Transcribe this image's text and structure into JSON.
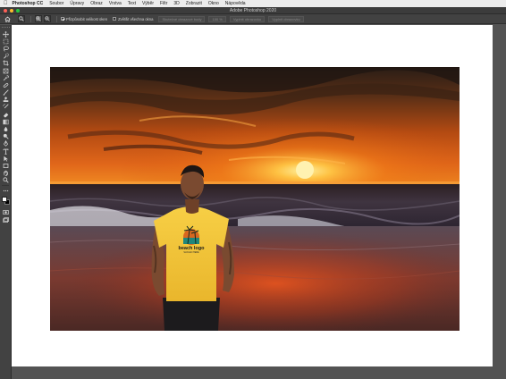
{
  "menubar": {
    "app_name": "Photoshop CC",
    "items": [
      "Soubor",
      "Úpravy",
      "Obraz",
      "Vrstva",
      "Text",
      "Výběr",
      "Filtr",
      "3D",
      "Zobrazit",
      "Okno",
      "Nápověda"
    ]
  },
  "window": {
    "title": "Adobe Photoshop 2020"
  },
  "options": {
    "checkbox1_label": "Přizpůsobit velikost oken",
    "checkbox1_checked": true,
    "checkbox2_label": "Zvětšit všechna okna",
    "checkbox2_checked": false,
    "buttons": [
      "Skutečné obrazové body",
      "100 %",
      "Vyplnit obrazovku",
      "Vyplnit obrazovku"
    ]
  },
  "tools": [
    "move-tool",
    "marquee-tool",
    "lasso-tool",
    "quick-select-tool",
    "crop-tool",
    "frame-tool",
    "eyedropper-tool",
    "healing-brush-tool",
    "brush-tool",
    "clone-stamp-tool",
    "history-brush-tool",
    "eraser-tool",
    "gradient-tool",
    "blur-tool",
    "dodge-tool",
    "pen-tool",
    "type-tool",
    "path-select-tool",
    "rectangle-tool",
    "hand-tool",
    "zoom-tool",
    "more-tools"
  ],
  "colors": {
    "foreground": "#ffffff",
    "background": "#000000",
    "ui_dark": "#535353",
    "panel": "#424242"
  },
  "artwork": {
    "shirt_line1": "beach logo",
    "shirt_line2": "SLOGAN HERE"
  }
}
